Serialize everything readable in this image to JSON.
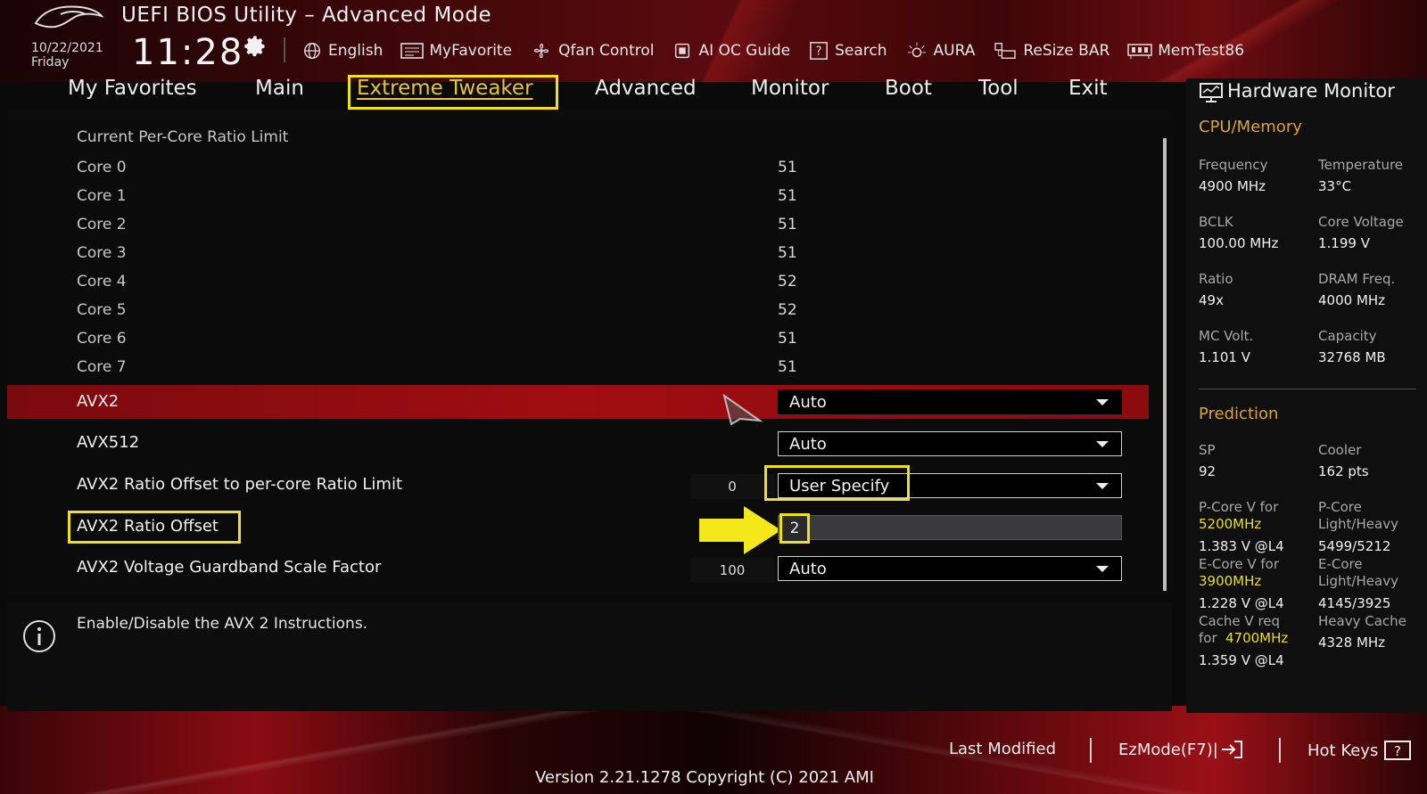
{
  "header": {
    "title": "UEFI BIOS Utility – Advanced Mode",
    "date": "10/22/2021",
    "day": "Friday",
    "time": "11:28"
  },
  "toolbar": {
    "items": [
      {
        "label": "English",
        "icon": "globe-icon"
      },
      {
        "label": "MyFavorite",
        "icon": "favorite-list-icon"
      },
      {
        "label": "Qfan Control",
        "icon": "fan-icon"
      },
      {
        "label": "AI OC Guide",
        "icon": "oc-guide-icon"
      },
      {
        "label": "Search",
        "icon": "search-help-icon"
      },
      {
        "label": "AURA",
        "icon": "aura-icon"
      },
      {
        "label": "ReSize BAR",
        "icon": "resize-bar-icon"
      },
      {
        "label": "MemTest86",
        "icon": "memtest-icon"
      }
    ]
  },
  "tabs": [
    {
      "label": "My Favorites"
    },
    {
      "label": "Main"
    },
    {
      "label": "Extreme Tweaker",
      "active": true
    },
    {
      "label": "Advanced"
    },
    {
      "label": "Monitor"
    },
    {
      "label": "Boot"
    },
    {
      "label": "Tool"
    },
    {
      "label": "Exit"
    }
  ],
  "settings": {
    "section_label": "Current Per-Core Ratio Limit",
    "cores": [
      {
        "label": "Core 0",
        "value": "51"
      },
      {
        "label": "Core 1",
        "value": "51"
      },
      {
        "label": "Core 2",
        "value": "51"
      },
      {
        "label": "Core 3",
        "value": "51"
      },
      {
        "label": "Core 4",
        "value": "52"
      },
      {
        "label": "Core 5",
        "value": "52"
      },
      {
        "label": "Core 6",
        "value": "51"
      },
      {
        "label": "Core 7",
        "value": "51"
      }
    ],
    "avx2": {
      "label": "AVX2",
      "value": "Auto"
    },
    "avx512": {
      "label": "AVX512",
      "value": "Auto"
    },
    "avx2_offset_limit": {
      "label": "AVX2 Ratio Offset to per-core Ratio Limit",
      "current": "0",
      "value": "User Specify"
    },
    "avx2_ratio_offset": {
      "label": "AVX2 Ratio Offset",
      "value": "2"
    },
    "avx2_guardband": {
      "label": "AVX2 Voltage Guardband Scale Factor",
      "current": "100",
      "value": "Auto"
    }
  },
  "help": {
    "text": "Enable/Disable the AVX 2 Instructions."
  },
  "hardware_monitor": {
    "title": "Hardware Monitor",
    "cpu_section": "CPU/Memory",
    "cpu": [
      {
        "label": "Frequency",
        "value": "4900 MHz"
      },
      {
        "label": "Temperature",
        "value": "33°C"
      },
      {
        "label": "BCLK",
        "value": "100.00 MHz"
      },
      {
        "label": "Core Voltage",
        "value": "1.199 V"
      },
      {
        "label": "Ratio",
        "value": "49x"
      },
      {
        "label": "DRAM Freq.",
        "value": "4000 MHz"
      },
      {
        "label": "MC Volt.",
        "value": "1.101 V"
      },
      {
        "label": "Capacity",
        "value": "32768 MB"
      }
    ],
    "prediction_section": "Prediction",
    "sp_label": "SP",
    "sp_value": "92",
    "cooler_label": "Cooler",
    "cooler_value": "162 pts",
    "pcore_v_label": "P-Core V for",
    "pcore_v_freq": "5200MHz",
    "pcore_v_value": "1.383 V @L4",
    "pcore_lh_label1": "P-Core",
    "pcore_lh_label2": "Light/Heavy",
    "pcore_lh_value": "5499/5212",
    "ecore_v_label": "E-Core V for",
    "ecore_v_freq": "3900MHz",
    "ecore_v_value": "1.228 V @L4",
    "ecore_lh_label1": "E-Core",
    "ecore_lh_label2": "Light/Heavy",
    "ecore_lh_value": "4145/3925",
    "cache_v_label1": "Cache V req",
    "cache_v_label2": "for",
    "cache_v_freq": "4700MHz",
    "cache_v_value": "1.359 V @L4",
    "heavy_cache_label": "Heavy Cache",
    "heavy_cache_value": "4328 MHz"
  },
  "footer": {
    "last_modified": "Last Modified",
    "ezmode": "EzMode(F7)|",
    "hotkeys": "Hot Keys",
    "version": "Version 2.21.1278 Copyright (C) 2021 AMI"
  },
  "colors": {
    "accent_yellow": "#f0e020",
    "active_tab": "#e8c23a",
    "section_orange": "#d9a437",
    "row_highlight": "#a00d12"
  }
}
